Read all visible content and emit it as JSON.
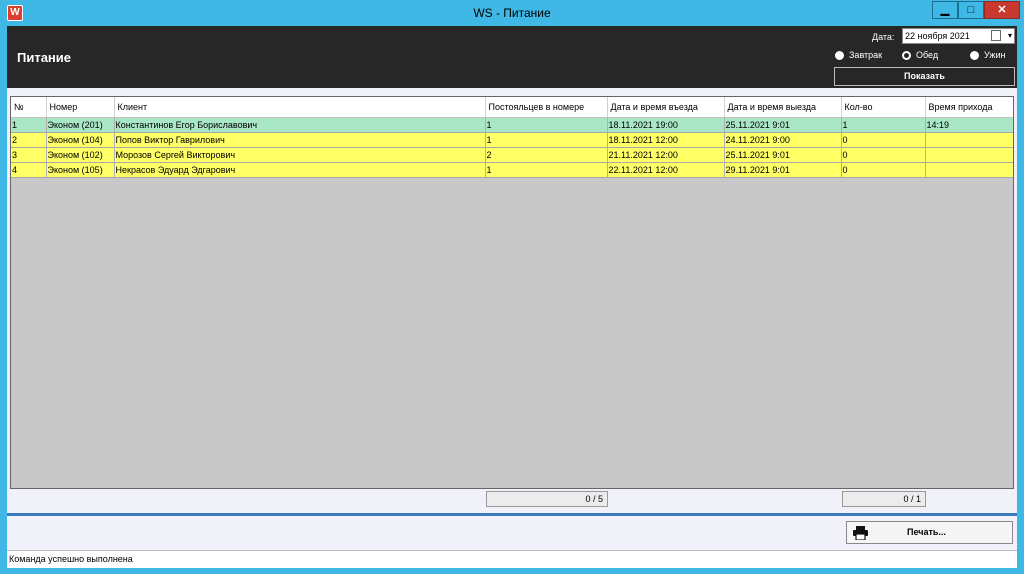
{
  "window": {
    "title": "WS - Питание",
    "icon_letter": "W",
    "minimize_glyph": "▁",
    "maximize_glyph": "□",
    "close_glyph": "✕"
  },
  "header": {
    "title": "Питание",
    "date_label": "Дата:",
    "date_value": "22  ноября  2021",
    "dropdown_glyph": "▾",
    "meals": [
      {
        "label": "Завтрак",
        "selected": false
      },
      {
        "label": "Обед",
        "selected": true
      },
      {
        "label": "Ужин",
        "selected": false
      }
    ],
    "show_button": "Показать"
  },
  "table": {
    "columns": [
      "№",
      "Номер",
      "Клиент",
      "Постояльцев в номере",
      "Дата и время въезда",
      "Дата и время выезда",
      "Кол-во",
      "Время прихода"
    ],
    "rows": [
      {
        "status": "green",
        "cells": [
          "1",
          "Эконом (201)",
          "Константинов Егор Бориславович",
          "1",
          "18.11.2021 19:00",
          "25.11.2021 9:01",
          "1",
          "14:19"
        ]
      },
      {
        "status": "yellow",
        "cells": [
          "2",
          "Эконом (104)",
          "Попов Виктор Гаврилович",
          "1",
          "18.11.2021 12:00",
          "24.11.2021 9:00",
          "0",
          ""
        ]
      },
      {
        "status": "yellow",
        "cells": [
          "3",
          "Эконом (102)",
          "Морозов Сергей Викторович",
          "2",
          "21.11.2021 12:00",
          "25.11.2021 9:01",
          "0",
          ""
        ]
      },
      {
        "status": "yellow",
        "cells": [
          "4",
          "Эконом (105)",
          "Некрасов Эдуард Эдгарович",
          "1",
          "22.11.2021 12:00",
          "29.11.2021 9:01",
          "0",
          ""
        ]
      }
    ]
  },
  "footer": {
    "counter_residents": "0 / 5",
    "counter_count": "0 / 1",
    "print_button": "Печать...",
    "status_text": "Команда успешно выполнена"
  },
  "colors": {
    "titlebar": "#3fb8e6",
    "header_bg": "#272727",
    "row_green": "#a8e6c6",
    "row_yellow": "#ffff66",
    "close_button": "#c7382e"
  }
}
